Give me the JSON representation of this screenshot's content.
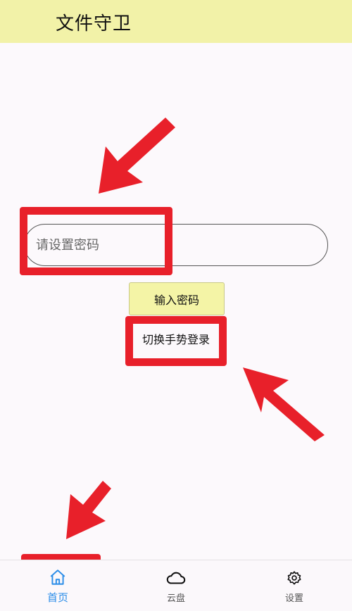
{
  "header": {
    "title": "文件守卫"
  },
  "login": {
    "password_placeholder": "请设置密码",
    "enter_button_label": "输入密码",
    "switch_label": "切换手势登录"
  },
  "bottom_nav": {
    "items": [
      {
        "label": "首页",
        "icon": "home-icon",
        "active": true
      },
      {
        "label": "云盘",
        "icon": "cloud-icon",
        "active": false
      },
      {
        "label": "设置",
        "icon": "gear-icon",
        "active": false
      }
    ]
  },
  "colors": {
    "header_bg": "#f2f2a8",
    "button_bg": "#f4f4a6",
    "highlight_red": "#e8202a",
    "active_blue": "#2b8de8"
  }
}
